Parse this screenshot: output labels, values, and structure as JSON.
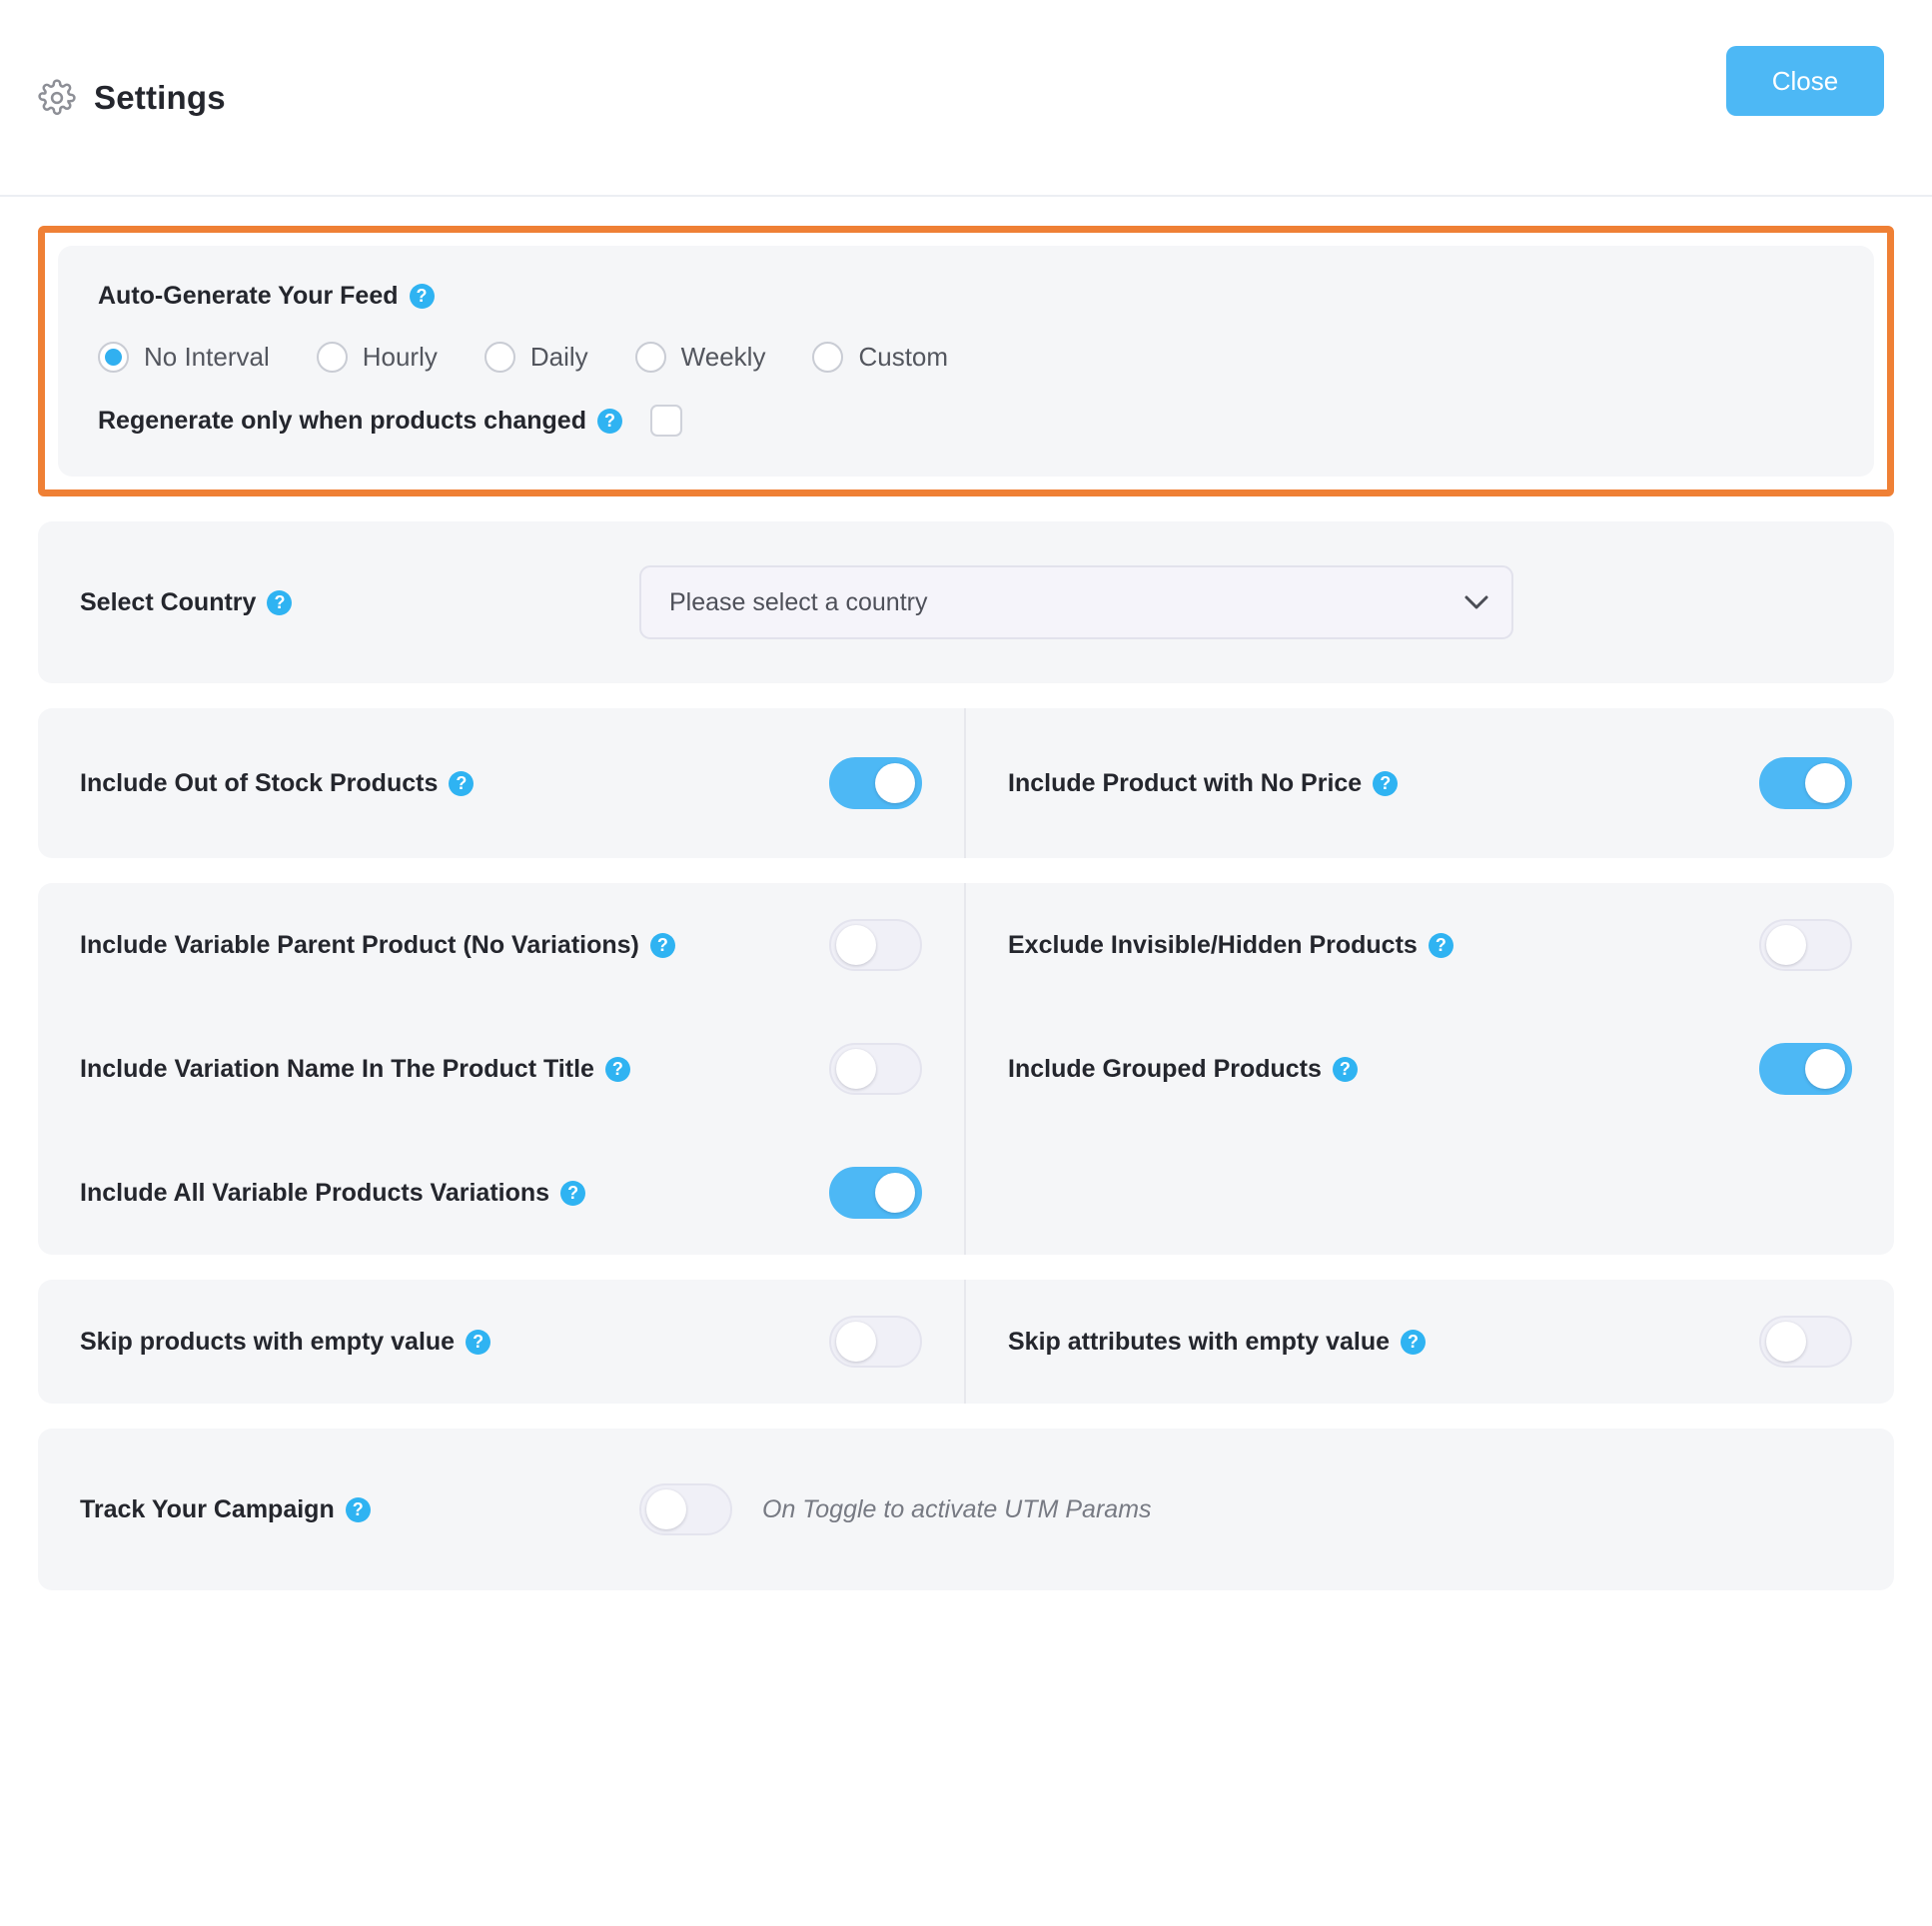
{
  "header": {
    "title": "Settings",
    "gear_icon": "gear-icon",
    "close_label": "Close",
    "close_color": "#4db8f5"
  },
  "highlight": {
    "border_color": "#ef8035",
    "arrow_color": "#ef8035",
    "arrow_direction": "left"
  },
  "autogen": {
    "label": "Auto-Generate Your Feed",
    "help_icon": "help-icon",
    "options": [
      {
        "label": "No Interval",
        "selected": true
      },
      {
        "label": "Hourly",
        "selected": false
      },
      {
        "label": "Daily",
        "selected": false
      },
      {
        "label": "Weekly",
        "selected": false
      },
      {
        "label": "Custom",
        "selected": false
      }
    ],
    "regenerate": {
      "label": "Regenerate only when products changed",
      "checked": false
    }
  },
  "country": {
    "label": "Select Country",
    "selected_value": "Please select a country",
    "chevron_icon": "chevron-down-icon"
  },
  "stock_row": {
    "left": {
      "label": "Include Out of Stock Products",
      "toggle": "on"
    },
    "right": {
      "label": "Include Product with No Price",
      "toggle": "on"
    }
  },
  "variations": {
    "rows": [
      {
        "left": {
          "label": "Include Variable Parent Product (No Variations)",
          "toggle": "off"
        },
        "right": {
          "label": "Exclude Invisible/Hidden Products",
          "toggle": "off"
        }
      },
      {
        "left": {
          "label": "Include Variation Name In The Product Title",
          "toggle": "off"
        },
        "right": {
          "label": "Include Grouped Products",
          "toggle": "on"
        }
      },
      {
        "left": {
          "label": "Include All Variable Products Variations",
          "toggle": "on"
        },
        "right": {
          "label": "",
          "toggle": "none"
        }
      }
    ]
  },
  "skip_row": {
    "left": {
      "label": "Skip products with empty value",
      "toggle": "off"
    },
    "right": {
      "label": "Skip attributes with empty value",
      "toggle": "off"
    }
  },
  "track": {
    "label": "Track Your Campaign",
    "toggle": "off",
    "note": "On Toggle to activate UTM Params"
  },
  "colors": {
    "accent_blue": "#4db8f5",
    "help_blue": "#2fb3f2",
    "panel_bg": "#f5f6f8",
    "highlight_orange": "#ef8035"
  }
}
